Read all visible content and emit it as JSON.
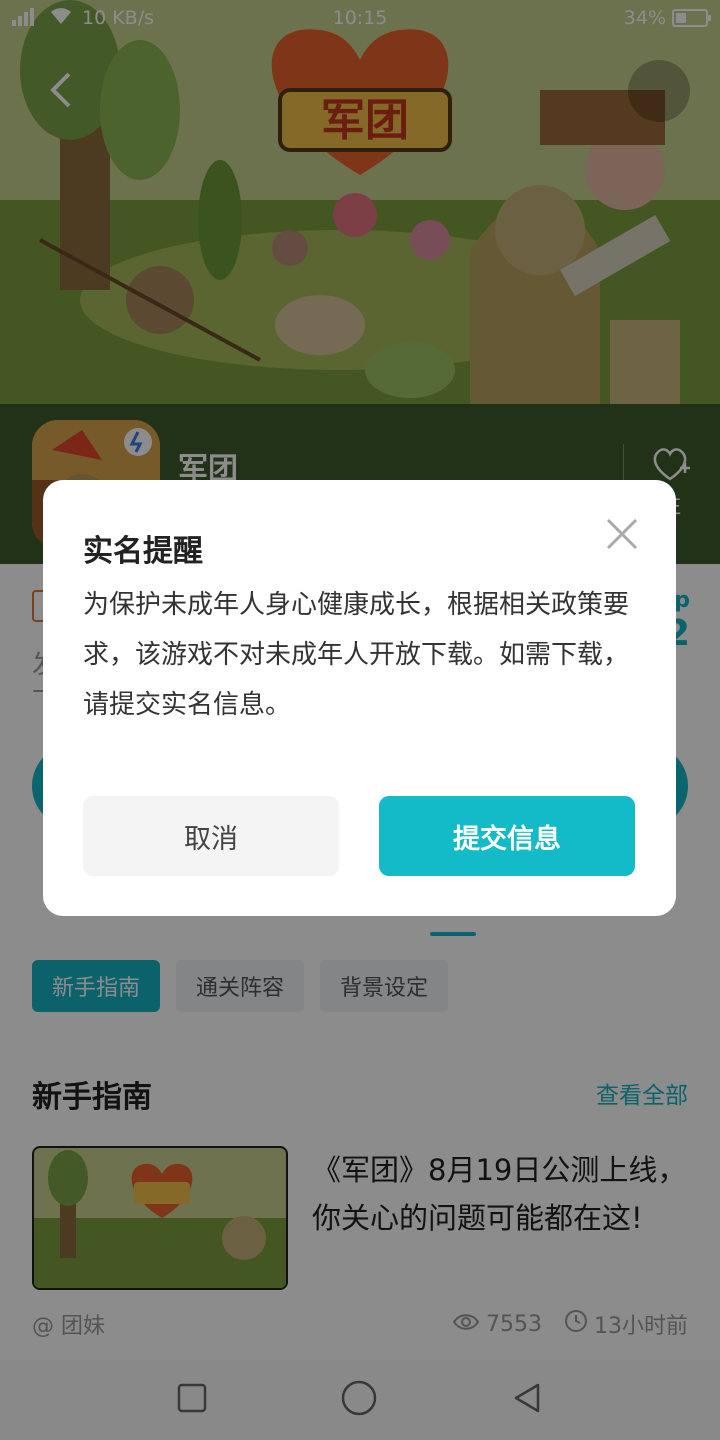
{
  "status_bar": {
    "network_speed": "10 KB/s",
    "time": "10:15",
    "battery": "34%"
  },
  "app": {
    "name": "军团",
    "follow_label": "注",
    "rating_partial": "p",
    "rating_partial2": "2",
    "info_partial1": "发",
    "info_partial2": "下"
  },
  "tabs": {
    "chips": [
      "新手指南",
      "通关阵容",
      "背景设定"
    ]
  },
  "section": {
    "title": "新手指南",
    "see_all": "查看全部"
  },
  "article": {
    "title": "《军团》8月19日公测上线，你关心的问题可能都在这!",
    "author": "@ 团妹",
    "views": "7553",
    "time_ago": "13小时前"
  },
  "dialog": {
    "title": "实名提醒",
    "body": "为保护未成年人身心健康成长，根据相关政策要求，该游戏不对未成年人开放下载。如需下载，请提交实名信息。",
    "cancel_label": "取消",
    "submit_label": "提交信息"
  },
  "banner": {
    "logo_text": "军团"
  },
  "colors": {
    "accent": "#13b8c8",
    "overlay": "rgba(0,0,0,0.45)"
  }
}
